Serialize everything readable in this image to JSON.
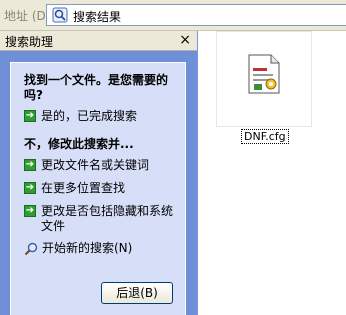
{
  "address_bar": {
    "label": "地址",
    "label_hotkey": "(D)",
    "value": "搜索结果"
  },
  "search_pane": {
    "title": "搜索助理",
    "close_glyph": "×",
    "question": "找到一个文件。是您需要的吗?",
    "yes_option": "是的，已完成搜索",
    "refine_heading": "不，修改此搜索并...",
    "refine_options": [
      "更改文件名或关键词",
      "在更多位置查找",
      "更改是否包括隐藏和系统文件"
    ],
    "new_search": "开始新的搜索(N)",
    "back_button": "后退(B)"
  },
  "results": {
    "file_name": "DNF.cfg"
  },
  "colors": {
    "pane_bg": "#6f90d9",
    "card_bg": "#d6dff7",
    "arrow_green": "#2f9e31"
  }
}
